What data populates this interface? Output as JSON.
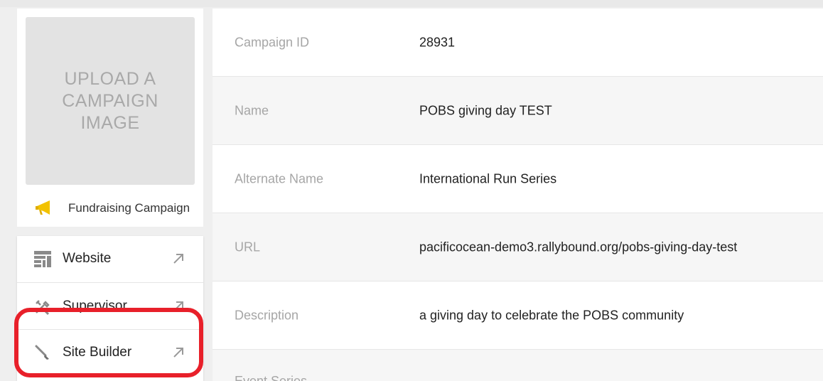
{
  "campaign": {
    "image_placeholder": "UPLOAD A CAMPAIGN IMAGE",
    "type_label": "Fundraising Campaign",
    "type_icon": "megaphone-icon"
  },
  "nav": {
    "items": [
      {
        "label": "Website",
        "icon": "layout-icon"
      },
      {
        "label": "Supervisor",
        "icon": "tools-icon"
      },
      {
        "label": "Site Builder",
        "icon": "brush-icon"
      }
    ],
    "arrow_icon": "external-arrow-icon"
  },
  "details": {
    "rows": [
      {
        "key": "Campaign ID",
        "value": "28931"
      },
      {
        "key": "Name",
        "value": "POBS giving day TEST"
      },
      {
        "key": "Alternate Name",
        "value": "International Run Series"
      },
      {
        "key": "URL",
        "value": "pacificocean-demo3.rallybound.org/pobs-giving-day-test"
      },
      {
        "key": "Description",
        "value": "a giving day to celebrate the POBS community"
      },
      {
        "key": "Event Series",
        "value": ""
      }
    ]
  },
  "colors": {
    "highlight": "#e8202a",
    "icon_yellow": "#f2c200"
  }
}
